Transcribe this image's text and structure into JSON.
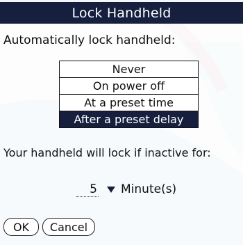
{
  "dialog": {
    "title": "Lock Handheld",
    "prompt": "Automatically lock handheld:",
    "options": [
      "Never",
      "On power off",
      "At a preset time",
      "After a preset delay"
    ],
    "selected_option": "After a preset delay",
    "info": "Your handheld will lock if inactive for:",
    "delay_value": "5",
    "delay_unit": "Minute(s)",
    "ok_label": "OK",
    "cancel_label": "Cancel"
  },
  "colors": {
    "title_bg": "#16203e",
    "selected_bg": "#16203e",
    "wallpaper_accent": "#b8dbe9"
  },
  "icons": {
    "dropdown": "triangle-down-icon"
  }
}
